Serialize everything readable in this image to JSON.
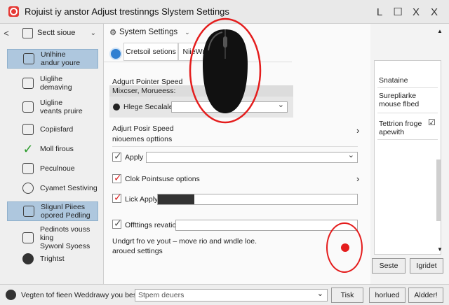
{
  "window": {
    "title": "Rojuist iy anstor  Adjust trestinngs   Slystem Settings",
    "controls": [
      "L",
      "☐",
      "X",
      "X"
    ]
  },
  "sidebar": {
    "back": "<",
    "header": "Sectt sioue",
    "chevron": "⌄",
    "items": [
      {
        "label": "Unlhine\nandur youre"
      },
      {
        "label": "Uiglihe\ndemaving"
      },
      {
        "label": "Uigline\nveants pruire"
      },
      {
        "label": "Copiisfard"
      },
      {
        "label": "Moll firous"
      },
      {
        "label": "Peculnoue"
      },
      {
        "label": "Cyamet Sestiving"
      },
      {
        "label": "Sligunl Piiees\nopored Pedling"
      },
      {
        "label": "Pedinots vouss king\nSywonl Syoess"
      },
      {
        "label": "Trightst"
      }
    ]
  },
  "main": {
    "breadcrumb": "System Settings",
    "tabs": [
      "Cretsoil setions",
      "NiieWnaings"
    ],
    "pointer_speed": {
      "title": "Adgurt Pointer Speed",
      "subtitle": "Mixcser, Morueess:",
      "option": "Hlege Secalalele"
    },
    "posir_speed": {
      "title": "Adjurt Posir Speed",
      "subtitle": "niouemes opttions"
    },
    "rows": [
      {
        "label": "Apply",
        "checked": true,
        "check_color": "#555555"
      },
      {
        "label": "Clok Pointsuse options",
        "checked": true,
        "check_color": "#d92020"
      },
      {
        "label": "Lick Apply",
        "checked": true,
        "check_color": "#d92020"
      },
      {
        "label": "Offttings revation",
        "checked": true,
        "check_color": "#555555"
      }
    ],
    "note": "Undgrt fro ve yout – move rio and wndle loe.\naroued settings",
    "arrow": "›"
  },
  "right_panel": {
    "heading": "Snataine",
    "text1": "Surepliarke\nmouse flbed",
    "text2": "Tettrion froge\napewith",
    "check": "☑"
  },
  "buttons": {
    "seste": "Seste",
    "igridet": "Igridet",
    "tisk": "Tisk",
    "horfued": "horlued",
    "aldder": "Aldder!"
  },
  "statusbar": {
    "text": "Vegten tof fieen Weddrawy you besstrulte",
    "field": "Stpem deuers",
    "chevron": "⌄"
  },
  "colors": {
    "accent": "#2f7fd1",
    "selection": "#aec7de",
    "highlight_red": "#e41d1d",
    "check_green": "#2b9b2b"
  }
}
